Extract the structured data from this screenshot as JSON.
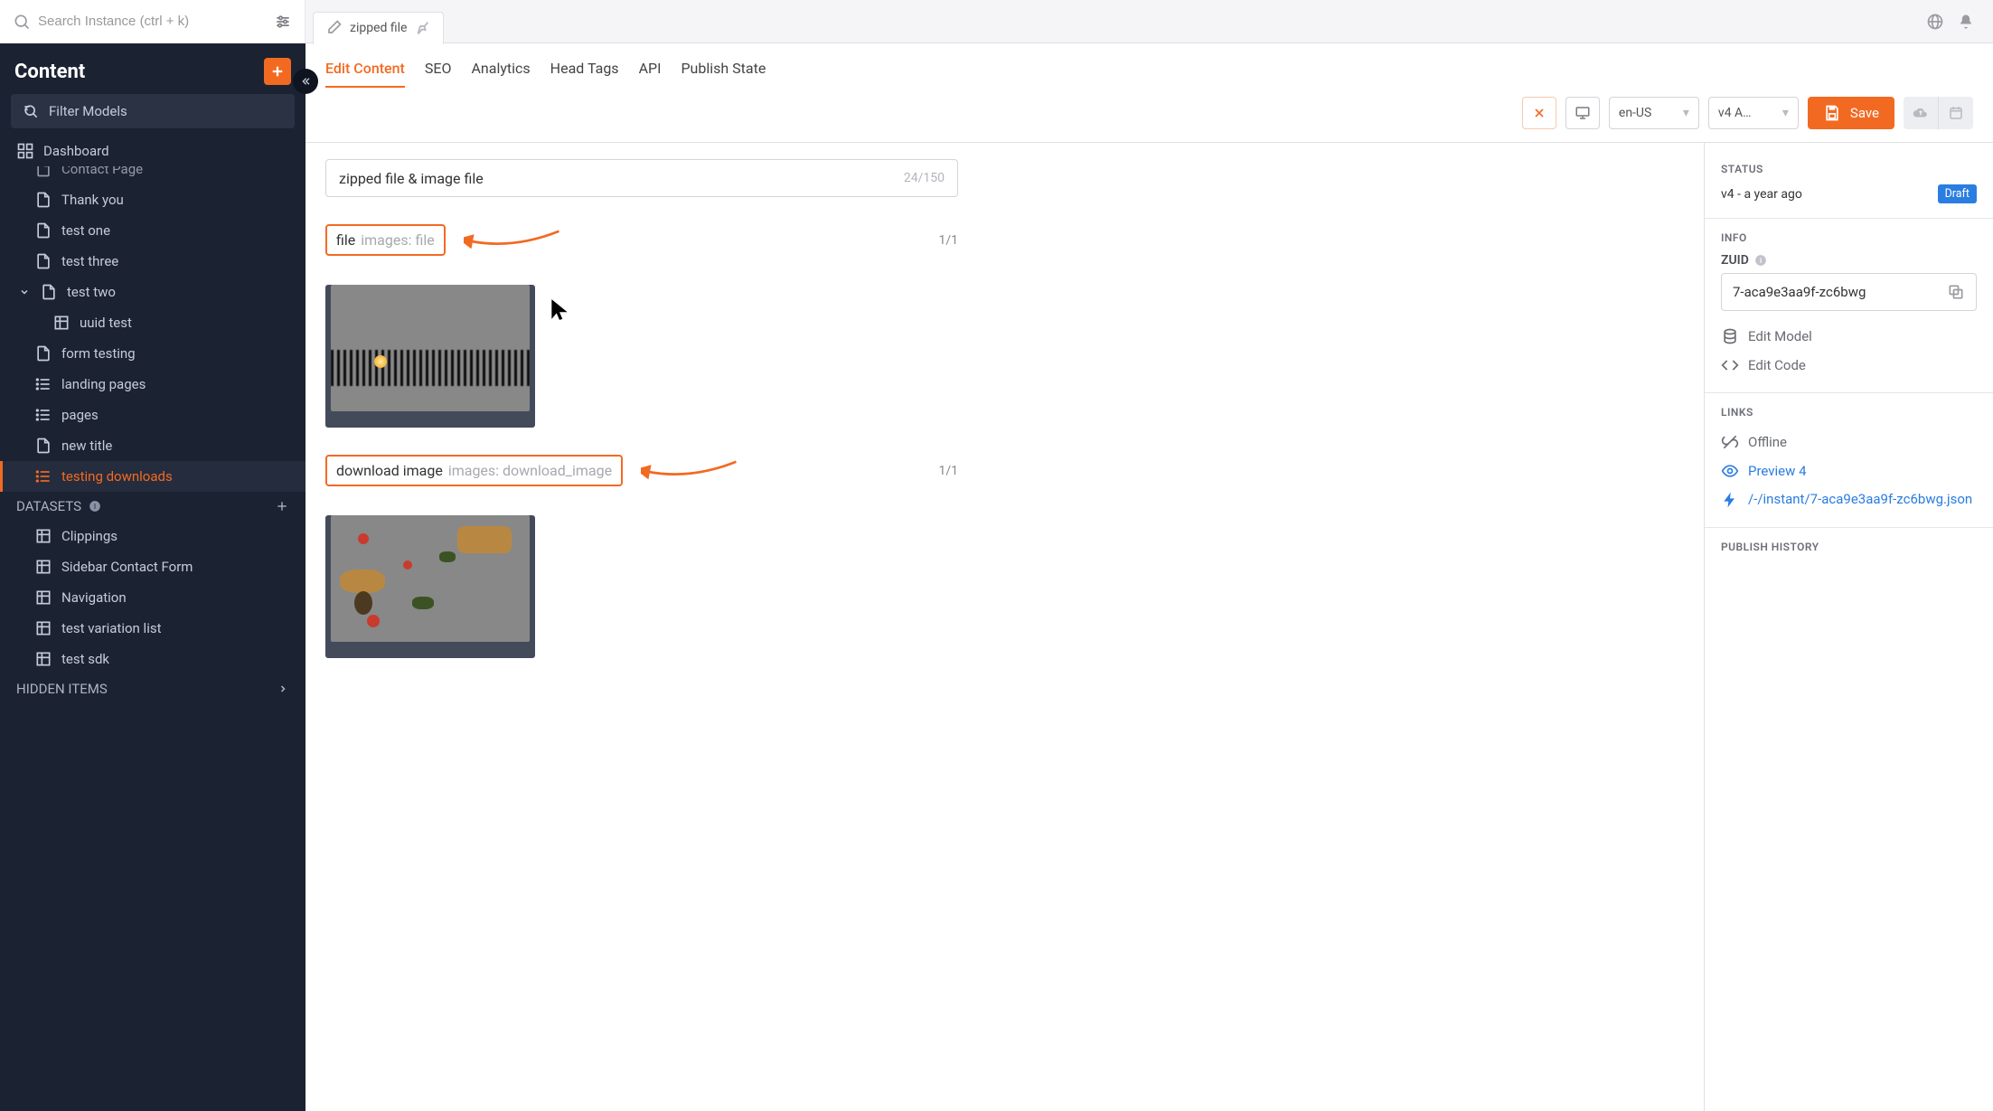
{
  "search": {
    "placeholder": "Search Instance (ctrl + k)"
  },
  "tab": {
    "title": "zipped file"
  },
  "sidebar": {
    "title": "Content",
    "filter_label": "Filter Models",
    "dashboard_label": "Dashboard",
    "items": [
      {
        "label": "Contact Page",
        "icon": "page",
        "level": 1
      },
      {
        "label": "Thank you",
        "icon": "page",
        "level": 1
      },
      {
        "label": "test one",
        "icon": "page",
        "level": 1
      },
      {
        "label": "test three",
        "icon": "page",
        "level": 1
      },
      {
        "label": "test two",
        "icon": "page",
        "level": 1,
        "expanded": true
      },
      {
        "label": "uuid test",
        "icon": "table",
        "level": 2
      },
      {
        "label": "form testing",
        "icon": "page",
        "level": 1
      },
      {
        "label": "landing pages",
        "icon": "list",
        "level": 1
      },
      {
        "label": "pages",
        "icon": "list",
        "level": 1
      },
      {
        "label": "new title",
        "icon": "page",
        "level": 1
      },
      {
        "label": "testing downloads",
        "icon": "list",
        "level": 1,
        "active": true
      }
    ],
    "datasets": {
      "head": "DATASETS",
      "items": [
        {
          "label": "Clippings"
        },
        {
          "label": "Sidebar Contact Form"
        },
        {
          "label": "Navigation"
        },
        {
          "label": "test variation list"
        },
        {
          "label": "test sdk"
        }
      ]
    },
    "hidden_head": "HIDDEN ITEMS"
  },
  "subtabs": [
    "Edit Content",
    "SEO",
    "Analytics",
    "Head Tags",
    "API",
    "Publish State"
  ],
  "toolbar": {
    "locale": "en-US",
    "version": "v4  A…",
    "save_label": "Save"
  },
  "title_field": {
    "value": "zipped file & image file",
    "counter": "24/150"
  },
  "field1": {
    "label": "file",
    "hint": "images: file",
    "count": "1/1"
  },
  "field2": {
    "label": "download image",
    "hint": "images: download_image",
    "count": "1/1"
  },
  "right": {
    "status_head": "STATUS",
    "status_text": "v4 - a year ago",
    "status_badge": "Draft",
    "info_head": "INFO",
    "zuid_label": "ZUID",
    "zuid_value": "7-aca9e3aa9f-zc6bwg",
    "edit_model": "Edit Model",
    "edit_code": "Edit Code",
    "links_head": "LINKS",
    "offline": "Offline",
    "preview": "Preview 4",
    "json_link": "/-/instant/7-aca9e3aa9f-zc6bwg.json",
    "publish_head": "PUBLISH HISTORY"
  }
}
